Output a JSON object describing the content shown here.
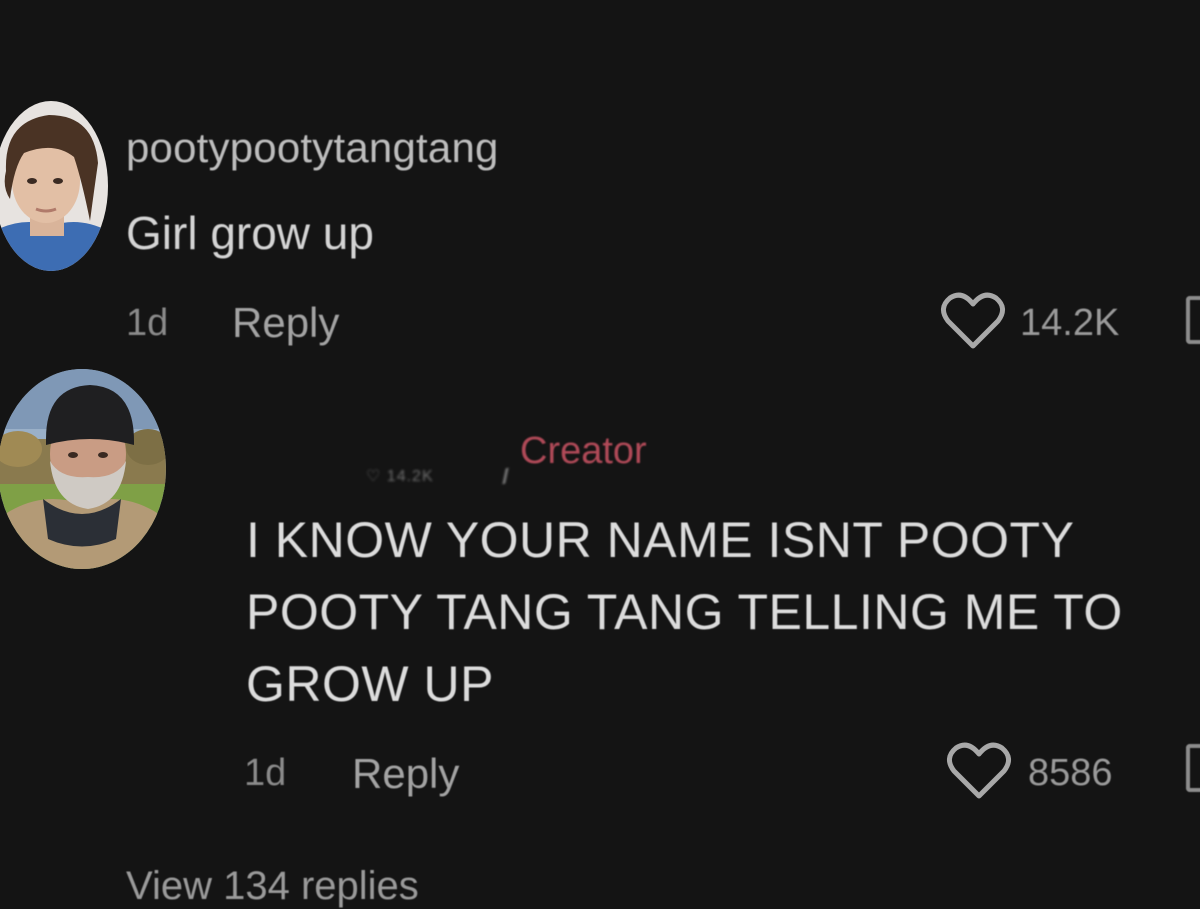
{
  "comments": [
    {
      "username": "pootypootytangtang",
      "text": "Girl grow up",
      "time": "1d",
      "reply_label": "Reply",
      "likes": "14.2K",
      "avatar": "avatar-young-person"
    },
    {
      "badge": "Creator",
      "ghost_likes": "14.2K",
      "text": "I KNOW YOUR NAME ISNT POOTY POOTY TANG TANG TELLING ME TO GROW UP",
      "time": "1d",
      "reply_label": "Reply",
      "likes": "8586",
      "avatar": "avatar-bearded-man-beanie"
    }
  ],
  "view_replies": "View 134 replies",
  "colors": {
    "background": "#141414",
    "text_primary": "#d4d4d4",
    "text_muted": "#8a8a8a",
    "creator_badge": "#b04a58"
  }
}
